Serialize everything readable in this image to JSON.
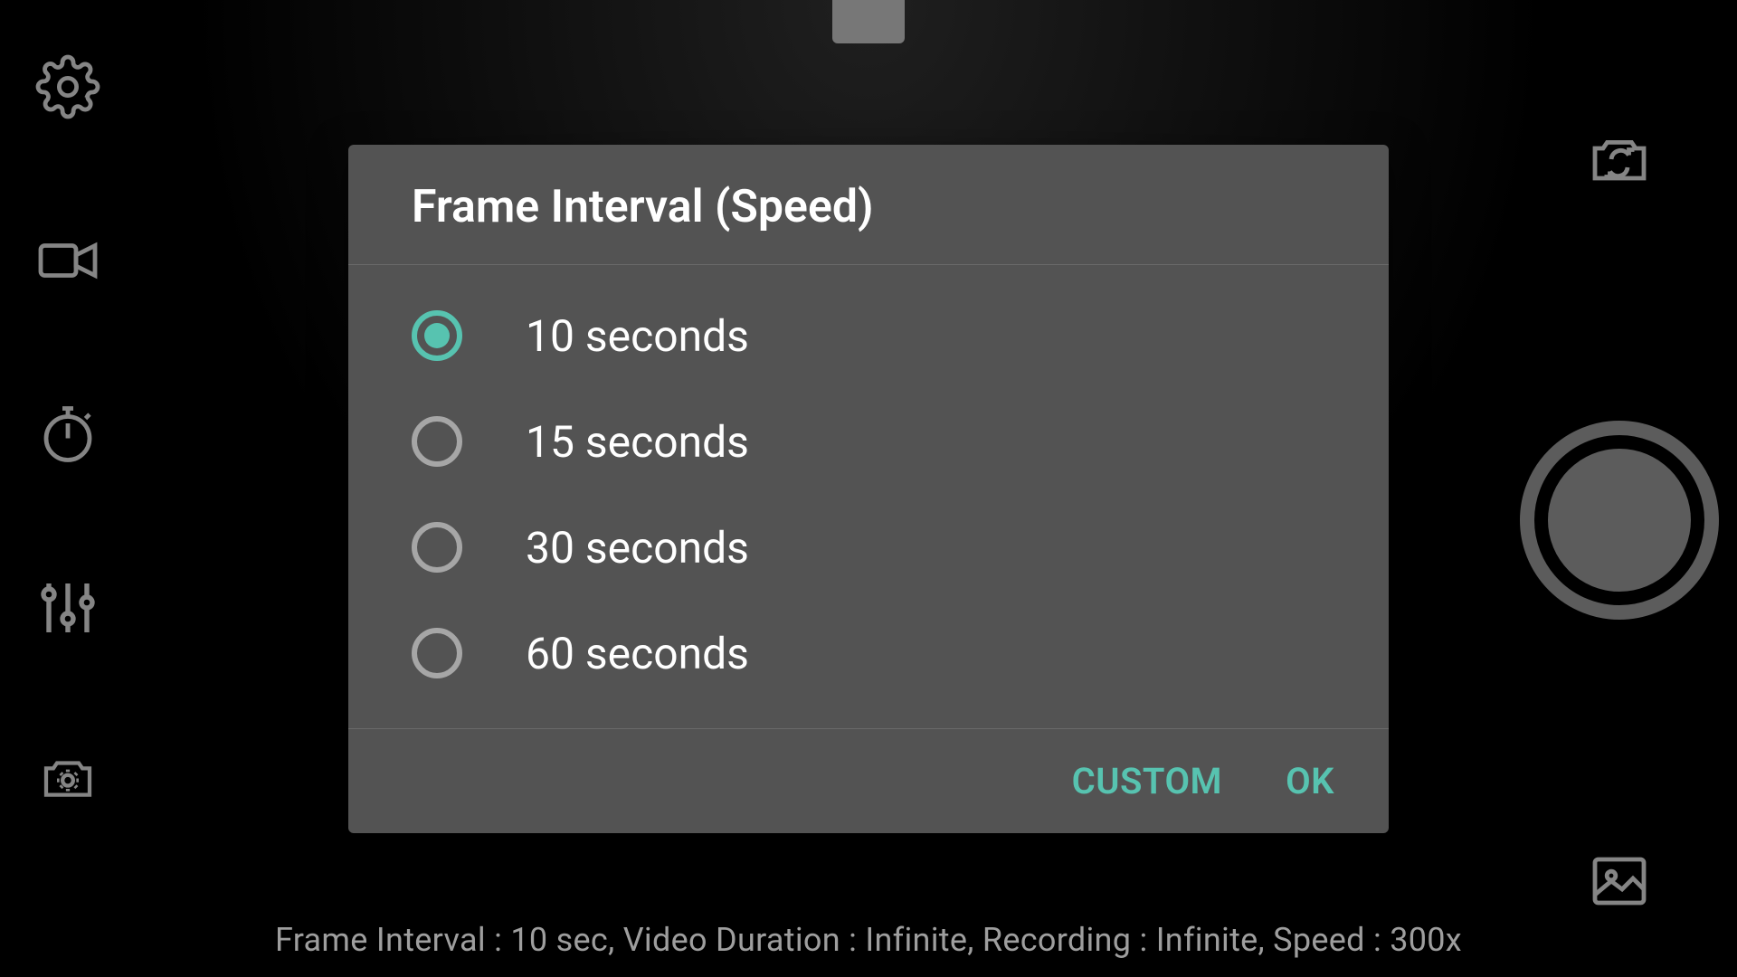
{
  "dialog": {
    "title": "Frame Interval (Speed)",
    "options": [
      "10 seconds",
      "15 seconds",
      "30 seconds",
      "60 seconds"
    ],
    "selectedIndex": 0,
    "actions": {
      "custom": "CUSTOM",
      "ok": "OK"
    }
  },
  "status": "Frame Interval : 10 sec, Video Duration : Infinite, Recording : Infinite, Speed : 300x",
  "icons": {
    "settings": "gear-icon",
    "video": "video-icon",
    "timer": "stopwatch-icon",
    "sliders": "sliders-icon",
    "cameraSettings": "camera-settings-icon",
    "cameraSwitch": "camera-switch-icon",
    "shutter": "shutter-button",
    "gallery": "gallery-icon"
  }
}
